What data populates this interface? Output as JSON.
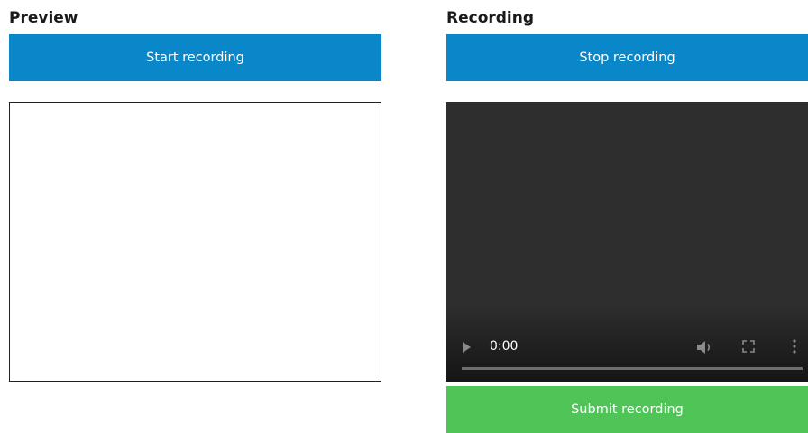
{
  "preview": {
    "title": "Preview",
    "start_button_label": "Start recording"
  },
  "recording": {
    "title": "Recording",
    "stop_button_label": "Stop recording",
    "submit_button_label": "Submit recording",
    "video": {
      "current_time": "0:00",
      "progress": 0,
      "icons": [
        "play-icon",
        "volume-icon",
        "fullscreen-icon",
        "more-options-icon"
      ]
    }
  },
  "colors": {
    "primary_button": "#0a87c9",
    "submit_button": "#4fc457",
    "video_background": "#2e2e2e"
  }
}
